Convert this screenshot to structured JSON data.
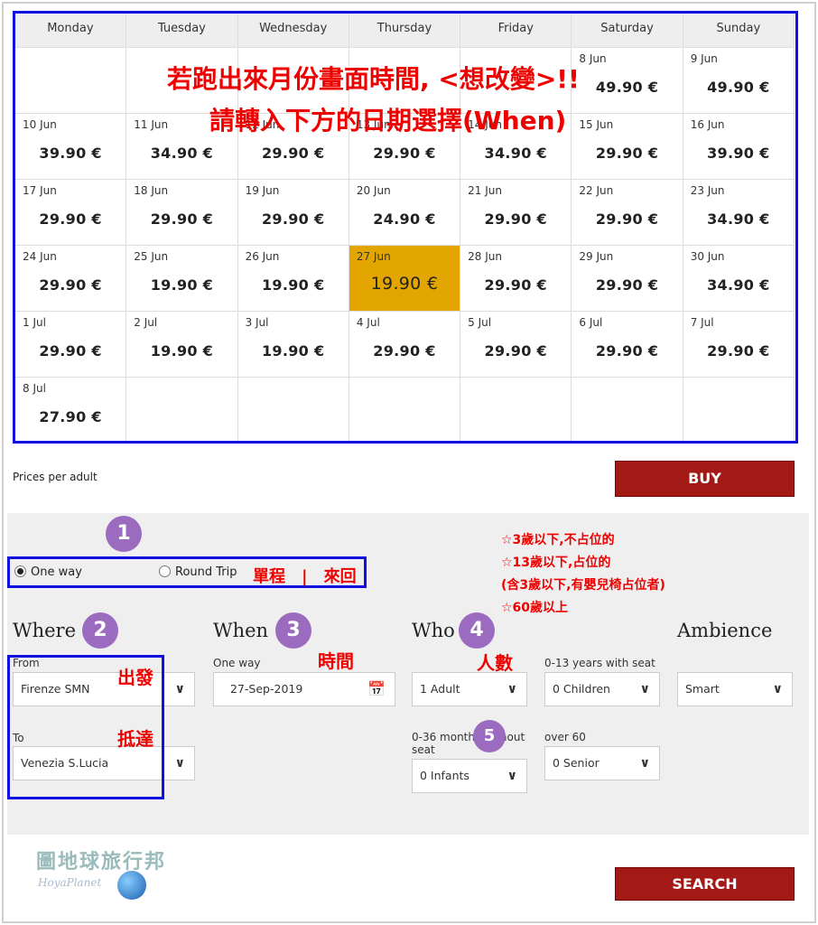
{
  "calendar": {
    "weekdays": [
      "Monday",
      "Tuesday",
      "Wednesday",
      "Thursday",
      "Friday",
      "Saturday",
      "Sunday"
    ],
    "weeks": [
      [
        null,
        null,
        null,
        null,
        null,
        {
          "date": "8 Jun",
          "price": "49.90 €"
        },
        {
          "date": "9 Jun",
          "price": "49.90 €"
        }
      ],
      [
        {
          "date": "10 Jun",
          "price": "39.90 €"
        },
        {
          "date": "11 Jun",
          "price": "34.90 €"
        },
        {
          "date": "12 Jun",
          "price": "29.90 €"
        },
        {
          "date": "13 Jun",
          "price": "29.90 €"
        },
        {
          "date": "14 Jun",
          "price": "34.90 €"
        },
        {
          "date": "15 Jun",
          "price": "29.90 €"
        },
        {
          "date": "16 Jun",
          "price": "39.90 €"
        }
      ],
      [
        {
          "date": "17 Jun",
          "price": "29.90 €"
        },
        {
          "date": "18 Jun",
          "price": "29.90 €"
        },
        {
          "date": "19 Jun",
          "price": "29.90 €"
        },
        {
          "date": "20 Jun",
          "price": "24.90 €"
        },
        {
          "date": "21 Jun",
          "price": "29.90 €"
        },
        {
          "date": "22 Jun",
          "price": "29.90 €"
        },
        {
          "date": "23 Jun",
          "price": "34.90 €"
        }
      ],
      [
        {
          "date": "24 Jun",
          "price": "29.90 €"
        },
        {
          "date": "25 Jun",
          "price": "19.90 €"
        },
        {
          "date": "26 Jun",
          "price": "19.90 €"
        },
        {
          "date": "27 Jun",
          "price": "19.90 €",
          "selected": true
        },
        {
          "date": "28 Jun",
          "price": "29.90 €"
        },
        {
          "date": "29 Jun",
          "price": "29.90 €"
        },
        {
          "date": "30 Jun",
          "price": "34.90 €"
        }
      ],
      [
        {
          "date": "1 Jul",
          "price": "29.90 €"
        },
        {
          "date": "2 Jul",
          "price": "19.90 €"
        },
        {
          "date": "3 Jul",
          "price": "19.90 €"
        },
        {
          "date": "4 Jul",
          "price": "29.90 €"
        },
        {
          "date": "5 Jul",
          "price": "29.90 €"
        },
        {
          "date": "6 Jul",
          "price": "29.90 €"
        },
        {
          "date": "7 Jul",
          "price": "29.90 €"
        }
      ],
      [
        {
          "date": "8 Jul",
          "price": "27.90 €"
        },
        null,
        null,
        null,
        null,
        null,
        null
      ]
    ],
    "selected_color": "#e3a600"
  },
  "annotations": {
    "calendar_note_1": "若跑出來月份畫面時間, <想改變>!!",
    "calendar_note_2": "請轉入下方的日期選擇(When)",
    "trip_type": "單程　|　來回",
    "from": "出發",
    "to": "抵達",
    "when": "時間",
    "who": "人數",
    "age_notes": [
      "☆3歲以下,不占位的",
      "☆13歲以下,占位的",
      "(含3歲以下,有嬰兒椅占位者)",
      "☆60歲以上"
    ],
    "badges": [
      "1",
      "2",
      "3",
      "4",
      "5"
    ]
  },
  "prices_note": "Prices per adult",
  "buy_label": "BUY",
  "search_label": "SEARCH",
  "trip": {
    "one_way": "One way",
    "round_trip": "Round Trip",
    "selected": "one_way"
  },
  "where": {
    "heading": "Where",
    "from_label": "From",
    "from_value": "Firenze SMN",
    "to_label": "To",
    "to_value": "Venezia S.Lucia"
  },
  "when": {
    "heading": "When",
    "label": "One way",
    "date": "27-Sep-2019"
  },
  "who": {
    "heading": "Who",
    "adults": "1 Adult",
    "children_label": "0-13 years with seat",
    "children": "0 Children",
    "infants_label": "0-36 months without seat",
    "infants": "0 Infants",
    "senior_label": "over 60",
    "senior": "0 Senior"
  },
  "ambience": {
    "heading": "Ambience",
    "value": "Smart"
  },
  "logo": {
    "text": "圖地球旅行邦",
    "sub": "HoyaPlanet"
  },
  "accent": "#a31916"
}
